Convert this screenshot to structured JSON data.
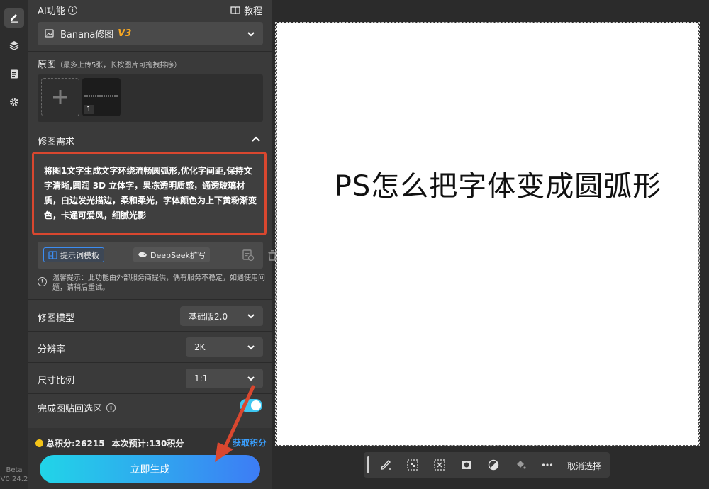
{
  "rail": {
    "items": [
      {
        "name": "edit-icon",
        "active": true
      },
      {
        "name": "layers-icon",
        "active": false
      },
      {
        "name": "clipboard-icon",
        "active": false
      },
      {
        "name": "gear-icon",
        "active": false
      }
    ],
    "beta": "Beta",
    "version": "V0.24.2"
  },
  "panel": {
    "ai_title": "AI功能",
    "tutorial": "教程",
    "model_name": "Banana修图",
    "model_version": "V3",
    "original_title": "原图",
    "original_hint": "（最多上传5张，长按图片可拖拽排序）",
    "thumb_index": "1",
    "requirement_title": "修图需求",
    "prompt_text": "将图1文字生成文字环绕流畅圆弧形,优化字间距,保持文字清晰,圆润 3D 立体字，果冻透明质感，通透玻璃材质，白边发光描边，柔和柔光，字体颜色为上下黄粉渐变色，卡通可爱风，细腻光影",
    "template_button": "提示词模板",
    "deepseek_button": "DeepSeek扩写",
    "notice": "温馨提示：此功能由外部服务商提供，偶有服务不稳定，如遇使用问题，请稍后重试。",
    "model_label": "修图模型",
    "model_value": "基础版2.0",
    "resolution_label": "分辨率",
    "resolution_value": "2K",
    "ratio_label": "尺寸比例",
    "ratio_value": "1:1",
    "paste_label": "完成图贴回选区",
    "paste_enabled": true,
    "credits_total": "总积分:26215",
    "credits_estimate": "本次预计:130积分",
    "get_credits": "获取积分",
    "generate_button": "立即生成"
  },
  "canvas": {
    "text": "PS怎么把字体变成圆弧形"
  },
  "toolbar": {
    "icons": [
      "brush-select-icon",
      "select-subject-icon",
      "invert-selection-icon",
      "mask-icon",
      "contrast-icon",
      "fill-icon",
      "more-icon"
    ],
    "deselect": "取消选择"
  },
  "colors": {
    "accent_blue": "#3aa0ff",
    "gradient_start": "#21d5e8",
    "gradient_end": "#3d7cf5",
    "annotation_red": "#d9472f",
    "version_orange": "#f5a623"
  }
}
